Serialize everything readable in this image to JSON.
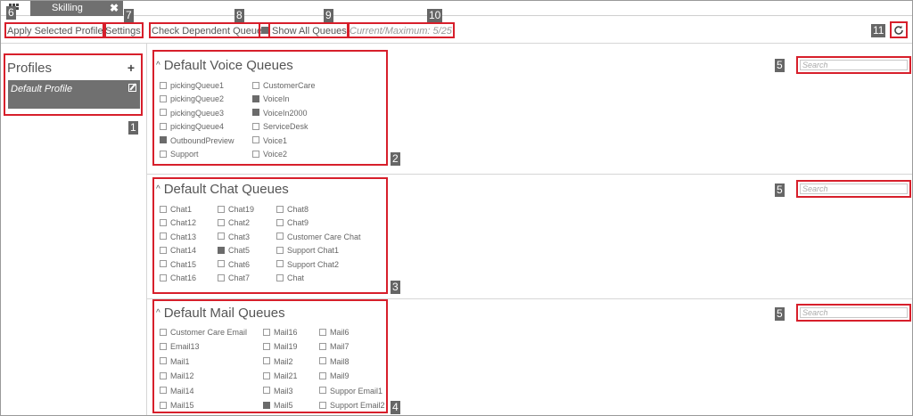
{
  "tab": {
    "label": "Skilling",
    "close": "✖"
  },
  "toolbar": {
    "apply_label": "Apply Selected Profile",
    "settings_label": "Settings",
    "check_dependent_label": "Check Dependent Queues",
    "show_all_label": "Show All Queues",
    "counter": "Current/Maximum: 5/25"
  },
  "profiles": {
    "title": "Profiles",
    "add": "+",
    "items": [
      {
        "label": "Default Profile"
      }
    ]
  },
  "search_placeholder": "Search",
  "badges": [
    "1",
    "2",
    "3",
    "4",
    "5",
    "6",
    "7",
    "8",
    "9",
    "10",
    "11"
  ],
  "sections": {
    "voice": {
      "title": "Default Voice Queues",
      "queues": [
        {
          "name": "pickingQueue1",
          "checked": false
        },
        {
          "name": "pickingQueue2",
          "checked": false
        },
        {
          "name": "pickingQueue3",
          "checked": false
        },
        {
          "name": "pickingQueue4",
          "checked": false
        },
        {
          "name": "OutboundPreview",
          "checked": true
        },
        {
          "name": "Support",
          "checked": false
        },
        {
          "name": "CustomerCare",
          "checked": false
        },
        {
          "name": "VoiceIn",
          "checked": true
        },
        {
          "name": "VoiceIn2000",
          "checked": true
        },
        {
          "name": "ServiceDesk",
          "checked": false
        },
        {
          "name": "Voice1",
          "checked": false
        },
        {
          "name": "Voice2",
          "checked": false
        }
      ]
    },
    "chat": {
      "title": "Default Chat Queues",
      "queues": [
        {
          "name": "Chat1",
          "checked": false
        },
        {
          "name": "Chat12",
          "checked": false
        },
        {
          "name": "Chat13",
          "checked": false
        },
        {
          "name": "Chat14",
          "checked": false
        },
        {
          "name": "Chat15",
          "checked": false
        },
        {
          "name": "Chat16",
          "checked": false
        },
        {
          "name": "Chat19",
          "checked": false
        },
        {
          "name": "Chat2",
          "checked": false
        },
        {
          "name": "Chat3",
          "checked": false
        },
        {
          "name": "Chat5",
          "checked": true
        },
        {
          "name": "Chat6",
          "checked": false
        },
        {
          "name": "Chat7",
          "checked": false
        },
        {
          "name": "Chat8",
          "checked": false
        },
        {
          "name": "Chat9",
          "checked": false
        },
        {
          "name": "Customer Care Chat",
          "checked": false
        },
        {
          "name": "Support Chat1",
          "checked": false
        },
        {
          "name": "Support Chat2",
          "checked": false
        },
        {
          "name": "Chat",
          "checked": false
        }
      ]
    },
    "mail": {
      "title": "Default Mail Queues",
      "queues": [
        {
          "name": "Customer Care Email",
          "checked": false
        },
        {
          "name": "Email13",
          "checked": false
        },
        {
          "name": "Mail1",
          "checked": false
        },
        {
          "name": "Mail12",
          "checked": false
        },
        {
          "name": "Mail14",
          "checked": false
        },
        {
          "name": "Mail15",
          "checked": false
        },
        {
          "name": "Mail16",
          "checked": false
        },
        {
          "name": "Mail19",
          "checked": false
        },
        {
          "name": "Mail2",
          "checked": false
        },
        {
          "name": "Mail21",
          "checked": false
        },
        {
          "name": "Mail3",
          "checked": false
        },
        {
          "name": "Mail5",
          "checked": true
        },
        {
          "name": "Mail6",
          "checked": false
        },
        {
          "name": "Mail7",
          "checked": false
        },
        {
          "name": "Mail8",
          "checked": false
        },
        {
          "name": "Mail9",
          "checked": false
        },
        {
          "name": "Suppor Email1",
          "checked": false
        },
        {
          "name": "Support Email2",
          "checked": false
        }
      ]
    }
  },
  "colors": {
    "highlight": "#d71f2b",
    "accent_gray": "#707070"
  }
}
